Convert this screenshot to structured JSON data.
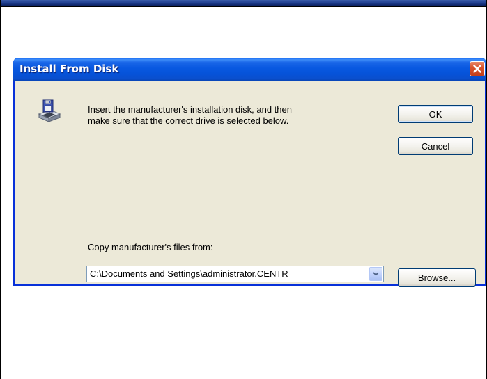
{
  "dialog": {
    "title": "Install From Disk",
    "message": "Insert the manufacturer's installation disk, and then make sure that the correct drive is selected below.",
    "message_line1": "Insert the manufacturer's installation disk, and then",
    "message_line2": "make sure that the correct drive is selected below.",
    "ok_label": "OK",
    "cancel_label": "Cancel",
    "copy_label": "Copy manufacturer's files from:",
    "path_value": "C:\\Documents and Settings\\administrator.CENTR",
    "browse_label": "Browse..."
  },
  "icons": {
    "close": "close-icon",
    "disk": "disk-drive-icon",
    "dropdown": "chevron-down-icon"
  },
  "colors": {
    "titlebar": "#0a58e0",
    "close_button": "#d9542f",
    "dialog_bg": "#ece9d8",
    "button_border": "#003c74"
  }
}
